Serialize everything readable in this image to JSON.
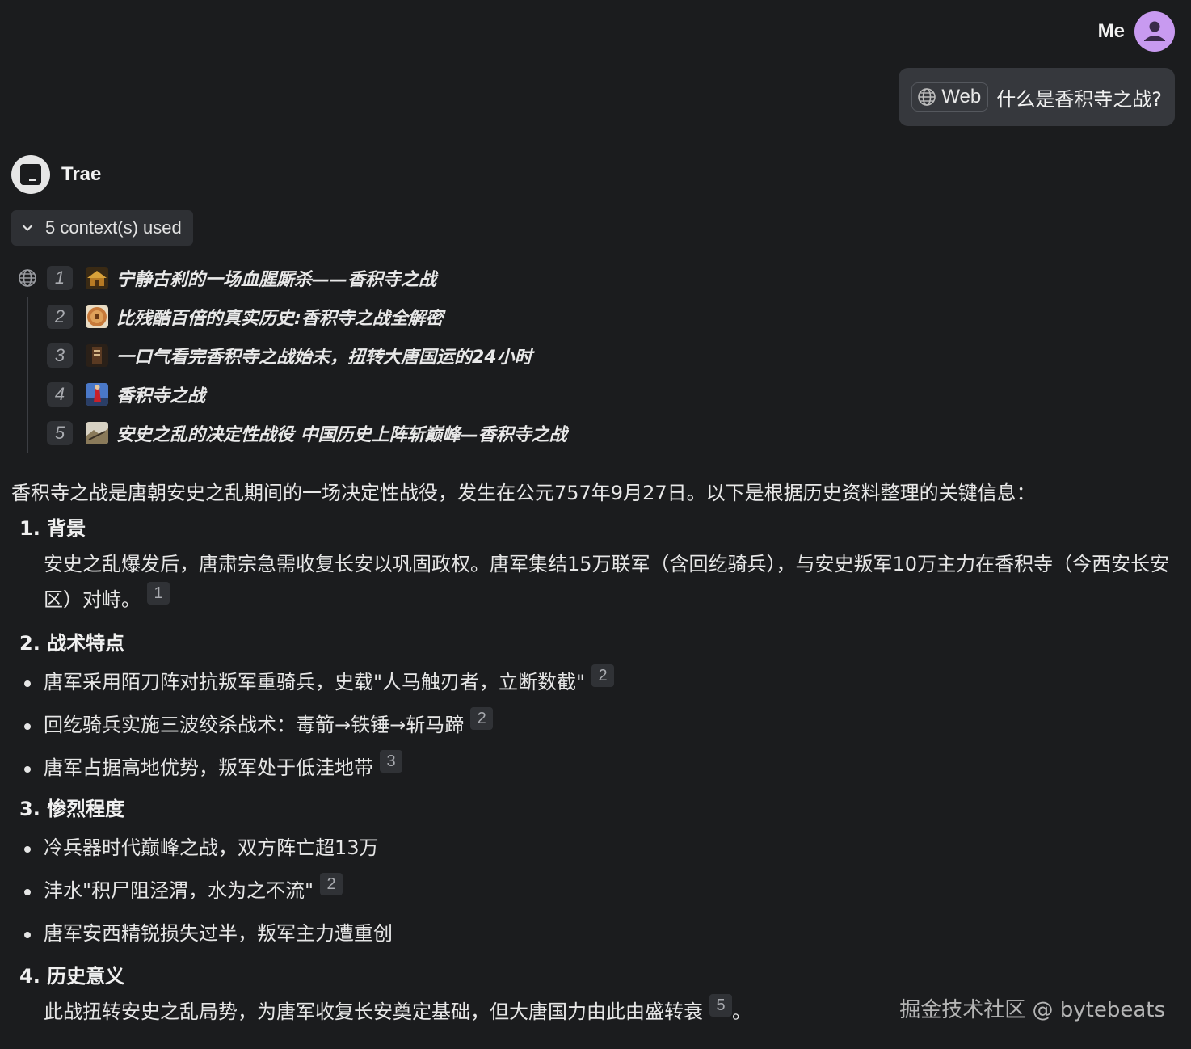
{
  "user": {
    "name": "Me"
  },
  "user_message": {
    "chip_label": "Web",
    "question": "什么是香积寺之战?"
  },
  "assistant": {
    "name": "Trae"
  },
  "contexts": {
    "toggle_label": "5 context(s) used",
    "items": [
      {
        "index": "1",
        "title": "宁静古刹的一场血腥厮杀——香积寺之战",
        "thumb": "temple-thumbnail"
      },
      {
        "index": "2",
        "title": "比残酷百倍的真实历史:香积寺之战全解密",
        "thumb": "coin-thumbnail"
      },
      {
        "index": "3",
        "title": "一口气看完香积寺之战始末，扭转大唐国运的24小时",
        "thumb": "book-thumbnail"
      },
      {
        "index": "4",
        "title": "香积寺之战",
        "thumb": "warrior-thumbnail"
      },
      {
        "index": "5",
        "title": "安史之乱的决定性战役 中国历史上阵斩巅峰—香积寺之战",
        "thumb": "battle-thumbnail"
      }
    ]
  },
  "answer": {
    "intro": "香积寺之战是唐朝安史之乱期间的一场决定性战役，发生在公元757年9月27日。以下是根据历史资料整理的关键信息：",
    "sections": [
      {
        "title": "1. 背景",
        "body": "安史之乱爆发后，唐肃宗急需收复长安以巩固政权。唐军集结15万联军（含回纥骑兵），与安史叛军10万主力在香积寺（今西安长安区）对峙。",
        "cite": "1"
      },
      {
        "title": "2. 战术特点",
        "bullets": [
          {
            "text": "唐军采用陌刀阵对抗叛军重骑兵，史载\"人马触刃者，立断数截\"",
            "cite": "2"
          },
          {
            "text": "回纥骑兵实施三波绞杀战术：毒箭→铁锤→斩马蹄",
            "cite": "2"
          },
          {
            "text": "唐军占据高地优势，叛军处于低洼地带",
            "cite": "3"
          }
        ]
      },
      {
        "title": "3. 惨烈程度",
        "bullets": [
          {
            "text": "冷兵器时代巅峰之战，双方阵亡超13万",
            "cite": ""
          },
          {
            "text": "沣水\"积尸阻泾渭，水为之不流\"",
            "cite": "2"
          },
          {
            "text": "唐军安西精锐损失过半，叛军主力遭重创",
            "cite": ""
          }
        ]
      },
      {
        "title": "4. 历史意义",
        "body": "此战扭转安史之乱局势，为唐军收复长安奠定基础，但大唐国力由此由盛转衰",
        "cite": "5",
        "tail": "。"
      }
    ]
  },
  "watermark": "掘金技术社区 @ bytebeats",
  "colors": {
    "background": "#1b1c1e",
    "bubble": "#36383d",
    "avatar": "#c89af0"
  }
}
